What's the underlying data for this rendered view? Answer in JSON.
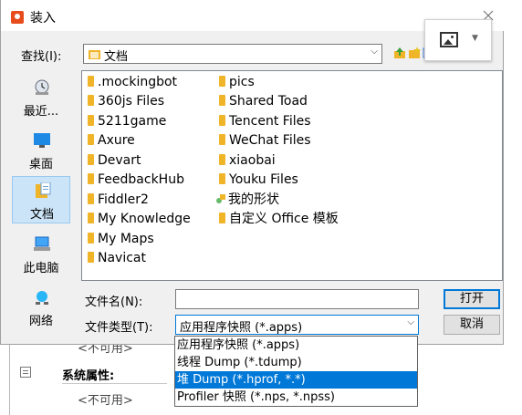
{
  "background": {
    "unavailable_top": "<不可用>",
    "system_props_label": "系统属性:",
    "unavailable_bottom": "<不可用>"
  },
  "dialog": {
    "title": "装入",
    "lookin_label": "查找(I):",
    "lookin_value": "文档",
    "places": [
      {
        "label": "最近...",
        "icon": "recent-icon"
      },
      {
        "label": "桌面",
        "icon": "desktop-icon"
      },
      {
        "label": "文档",
        "icon": "documents-icon",
        "selected": true
      },
      {
        "label": "此电脑",
        "icon": "computer-icon"
      },
      {
        "label": "网络",
        "icon": "network-icon"
      }
    ],
    "files_col1": [
      ".mockingbot",
      "360js Files",
      "5211game",
      "Axure",
      "Devart",
      "FeedbackHub",
      "Fiddler2",
      "My Knowledge",
      "My Maps",
      "Navicat"
    ],
    "files_col2": [
      "pics",
      "Shared Toad",
      "Tencent Files",
      "WeChat Files",
      "xiaobai",
      "Youku Files",
      "我的形状",
      "自定义 Office 模板"
    ],
    "filename_label": "文件名(N):",
    "filename_value": "",
    "filetype_label": "文件类型(T):",
    "filetype_value": "应用程序快照 (*.apps)",
    "open_button": "打开",
    "cancel_button": "取消",
    "filetype_options": [
      "应用程序快照 (*.apps)",
      "线程 Dump (*.tdump)",
      "堆 Dump (*.hprof, *.*)",
      "Profiler 快照 (*.nps, *.npss)"
    ],
    "highlighted_option_index": 2
  },
  "colors": {
    "accent": "#0078d7",
    "folder": "#f0b429",
    "selected_place": "#cce4f7"
  }
}
